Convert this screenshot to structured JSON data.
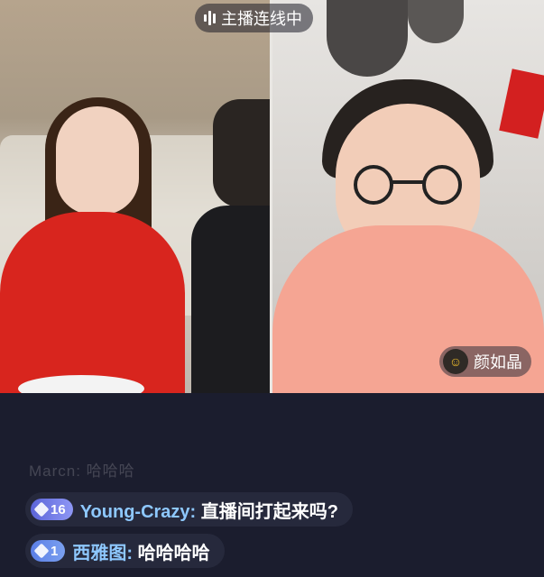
{
  "live_status": {
    "label": "主播连线中",
    "icon": "signal-bars-icon"
  },
  "guest": {
    "name": "颜如晶",
    "avatar_icon": "avatar"
  },
  "chat": {
    "faded_line": "Marcn: 哈哈哈",
    "messages": [
      {
        "level": "16",
        "username": "Young-Crazy",
        "separator": ":",
        "text": "直播间打起来吗?"
      },
      {
        "level": "1",
        "username": "西雅图",
        "separator": ":",
        "text": "哈哈哈哈"
      }
    ]
  },
  "colors": {
    "background": "#1b1d2e",
    "username": "#8ec8ff",
    "badge": "#6a74e0",
    "comment_bg": "#282b3e"
  }
}
